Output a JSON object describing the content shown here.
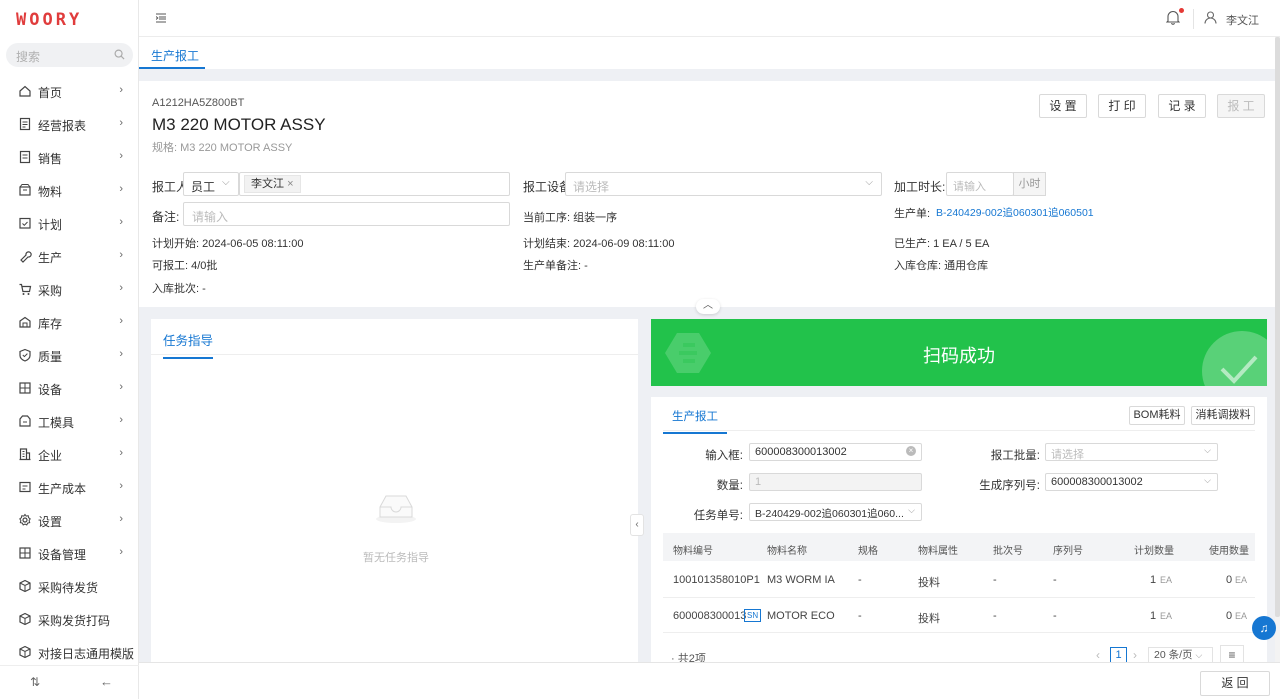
{
  "app": {
    "logo": "WOORY",
    "user_name": "李文江"
  },
  "sidebar": {
    "search_placeholder": "搜索",
    "items": [
      {
        "label": "首页",
        "icon": "home-icon",
        "chevron": true
      },
      {
        "label": "经营报表",
        "icon": "report-icon",
        "chevron": true
      },
      {
        "label": "销售",
        "icon": "sales-icon",
        "chevron": true
      },
      {
        "label": "物料",
        "icon": "box-icon",
        "chevron": true
      },
      {
        "label": "计划",
        "icon": "calendar-check-icon",
        "chevron": true
      },
      {
        "label": "生产",
        "icon": "wrench-icon",
        "chevron": true
      },
      {
        "label": "采购",
        "icon": "cart-icon",
        "chevron": true
      },
      {
        "label": "库存",
        "icon": "warehouse-icon",
        "chevron": true
      },
      {
        "label": "质量",
        "icon": "shield-check-icon",
        "chevron": true
      },
      {
        "label": "设备",
        "icon": "device-icon",
        "chevron": true
      },
      {
        "label": "工模具",
        "icon": "tool-icon",
        "chevron": true
      },
      {
        "label": "企业",
        "icon": "building-icon",
        "chevron": true
      },
      {
        "label": "生产成本",
        "icon": "cost-icon",
        "chevron": true
      },
      {
        "label": "设置",
        "icon": "gear-icon",
        "chevron": true
      },
      {
        "label": "设备管理",
        "icon": "device-manage-icon",
        "chevron": true
      },
      {
        "label": "采购待发货",
        "icon": "cube-icon",
        "chevron": false
      },
      {
        "label": "采购发货打码",
        "icon": "cube-icon",
        "chevron": false
      },
      {
        "label": "对接日志通用模版",
        "icon": "cube-icon",
        "chevron": false
      }
    ]
  },
  "tabs": [
    {
      "label": "生产报工",
      "active": true
    }
  ],
  "header": {
    "code": "A1212HA5Z800BT",
    "title": "M3 220 MOTOR ASSY",
    "spec": "规格: M3 220 MOTOR ASSY",
    "buttons": {
      "settings": "设 置",
      "print": "打 印",
      "record": "记 录",
      "report": "报 工"
    },
    "reporter_label": "报工人",
    "reporter_type": "员工",
    "reporter_tag": "李文江",
    "device_label": "报工设备",
    "device_placeholder": "请选择",
    "duration_label": "加工时长:",
    "duration_placeholder": "请输入",
    "duration_unit": "小时",
    "remark_label": "备注:",
    "remark_placeholder": "请输入",
    "current_process": "当前工序: 组装一序",
    "order_label": "生产单:",
    "order_value": "B-240429-002追060301追060501",
    "plan_start": "计划开始: 2024-06-05 08:11:00",
    "plan_end": "计划结束: 2024-06-09 08:11:00",
    "produced": "已生产: 1 EA / 5 EA",
    "reportable": "可报工: 4/0批",
    "order_remark": "生产单备注: -",
    "warehouse": "入库仓库: 通用仓库",
    "batch": "入库批次: -"
  },
  "task": {
    "tab": "任务指导",
    "empty": "暂无任务指导"
  },
  "scan": {
    "message": "扫码成功",
    "success_color": "#22c24b"
  },
  "report": {
    "tab": "生产报工",
    "bom_btn": "BOM耗料",
    "consume_btn": "消耗调拨料",
    "input_label": "输入框:",
    "input_value": "600008300013002",
    "batch_qty_label": "报工批量:",
    "batch_qty_placeholder": "请选择",
    "qty_label": "数量:",
    "qty_value": "1",
    "serial_label": "生成序列号:",
    "serial_value": "600008300013002",
    "task_no_label": "任务单号:",
    "task_no_value": "B-240429-002追060301追060..."
  },
  "table": {
    "headers": [
      "物料编号",
      "物料名称",
      "规格",
      "物料属性",
      "批次号",
      "序列号",
      "计划数量",
      "使用数量"
    ],
    "rows": [
      {
        "code": "100101358010P1",
        "sn": "",
        "name": "M3 WORM IA",
        "spec": "-",
        "attr": "投料",
        "batch": "-",
        "serial": "-",
        "plan": "1",
        "plan_unit": "EA",
        "used": "0",
        "used_unit": "EA"
      },
      {
        "code": "600008300013",
        "sn": "SN",
        "name": "MOTOR ECO",
        "spec": "-",
        "attr": "投料",
        "batch": "-",
        "serial": "-",
        "plan": "1",
        "plan_unit": "EA",
        "used": "0",
        "used_unit": "EA"
      }
    ],
    "total": "共2项",
    "page": "1",
    "page_size": "20 条/页"
  },
  "footer": {
    "back": "返 回"
  }
}
